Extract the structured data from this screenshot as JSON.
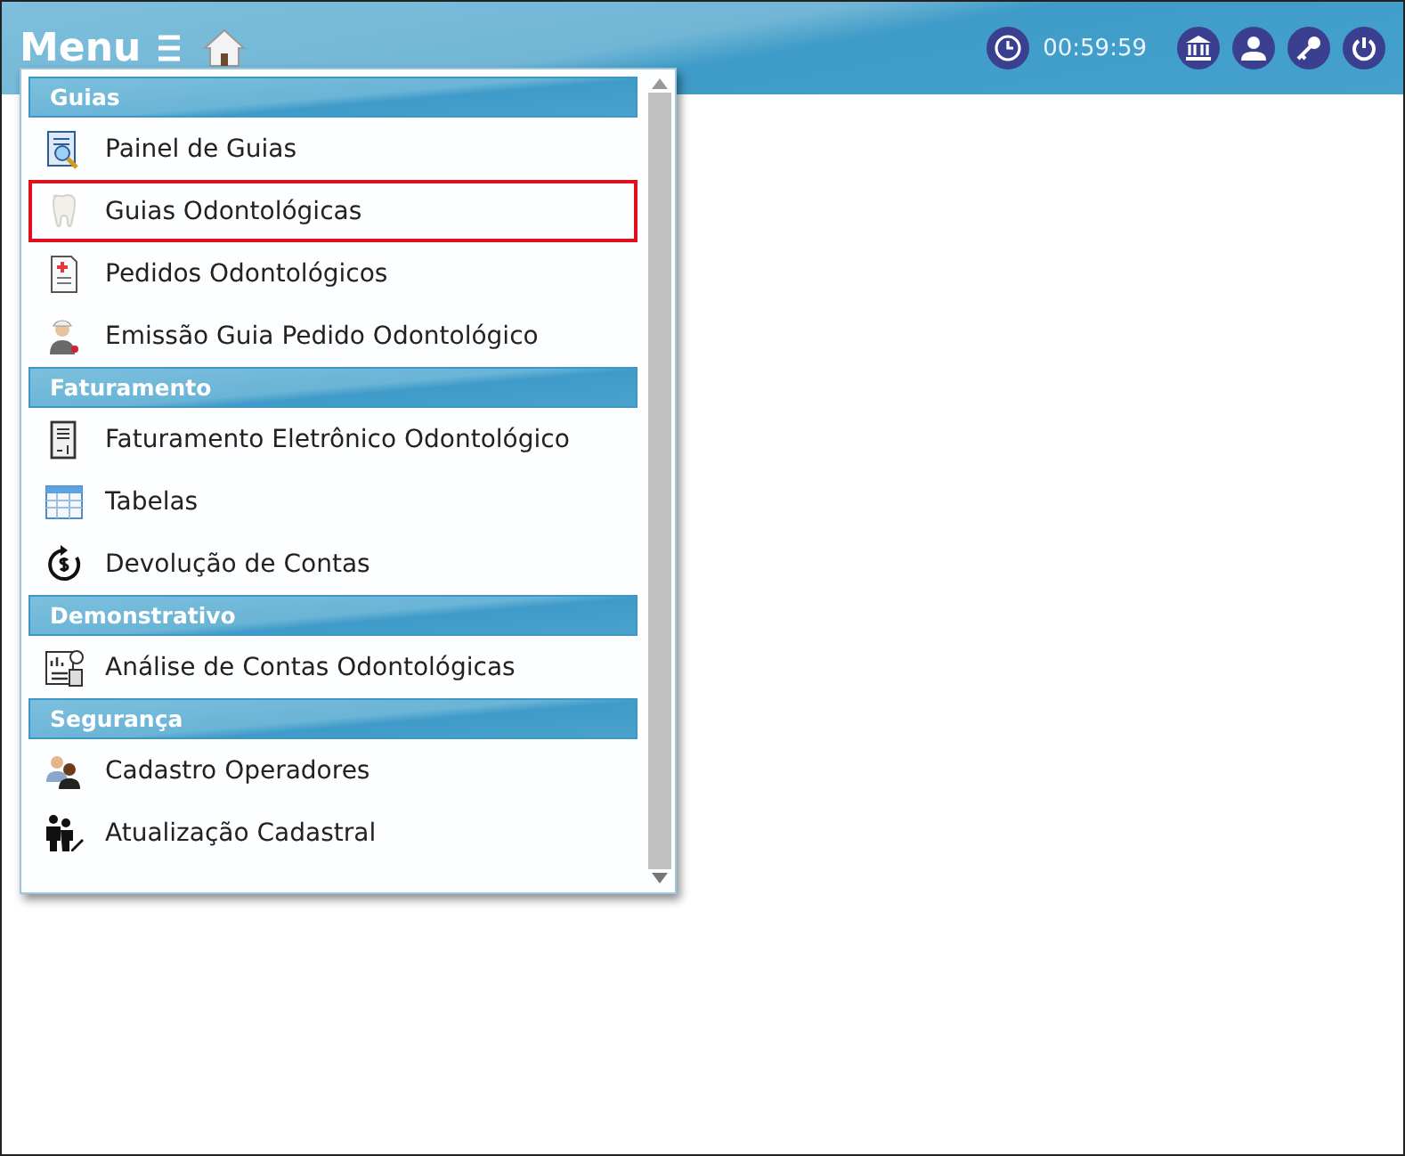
{
  "header": {
    "title": "Menu",
    "timer": "00:59:59"
  },
  "menu": {
    "sections": [
      {
        "title": "Guias",
        "items": [
          {
            "label": "Painel de Guias",
            "selected": false
          },
          {
            "label": "Guias Odontológicas",
            "selected": true
          },
          {
            "label": "Pedidos Odontológicos",
            "selected": false
          },
          {
            "label": "Emissão Guia Pedido Odontológico",
            "selected": false
          }
        ]
      },
      {
        "title": "Faturamento",
        "items": [
          {
            "label": "Faturamento Eletrônico Odontológico",
            "selected": false
          },
          {
            "label": "Tabelas",
            "selected": false
          },
          {
            "label": "Devolução de Contas",
            "selected": false
          }
        ]
      },
      {
        "title": "Demonstrativo",
        "items": [
          {
            "label": "Análise de Contas Odontológicas",
            "selected": false
          }
        ]
      },
      {
        "title": "Segurança",
        "items": [
          {
            "label": "Cadastro Operadores",
            "selected": false
          },
          {
            "label": "Atualização Cadastral",
            "selected": false
          }
        ]
      }
    ]
  }
}
